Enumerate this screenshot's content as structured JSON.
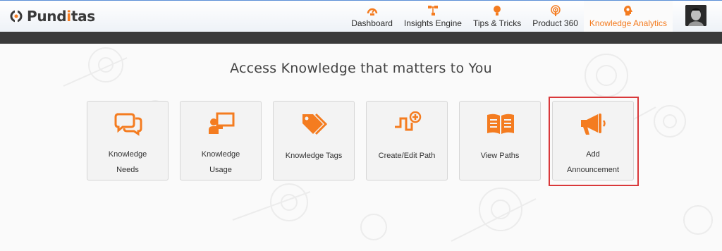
{
  "brand": {
    "prefix": "P",
    "name_a": "und",
    "name_i": "i",
    "name_b": "tas"
  },
  "nav": {
    "items": [
      {
        "label": "Dashboard",
        "icon": "speedometer-icon"
      },
      {
        "label": "Insights Engine",
        "icon": "flowchart-icon"
      },
      {
        "label": "Tips & Tricks",
        "icon": "lightbulb-icon"
      },
      {
        "label": "Product 360",
        "icon": "broadcast-icon"
      },
      {
        "label": "Knowledge Analytics",
        "icon": "gear-head-icon",
        "active": true
      }
    ]
  },
  "main": {
    "heading": "Access Knowledge that matters to You",
    "cards": [
      {
        "line1": "Knowledge",
        "line2": "Needs",
        "icon": "chat-bubbles-icon"
      },
      {
        "line1": "Knowledge",
        "line2": "Usage",
        "icon": "presenter-icon"
      },
      {
        "line1": "Knowledge Tags",
        "line2": "",
        "icon": "tags-icon"
      },
      {
        "line1": "Create/Edit Path",
        "line2": "",
        "icon": "path-plus-icon"
      },
      {
        "line1": "View Paths",
        "line2": "",
        "icon": "open-book-icon"
      },
      {
        "line1": "Add",
        "line2": "Announcement",
        "icon": "megaphone-icon"
      }
    ]
  },
  "colors": {
    "accent": "#f47c20",
    "highlight": "#d9383a",
    "darkbar": "#3a3a3a"
  }
}
